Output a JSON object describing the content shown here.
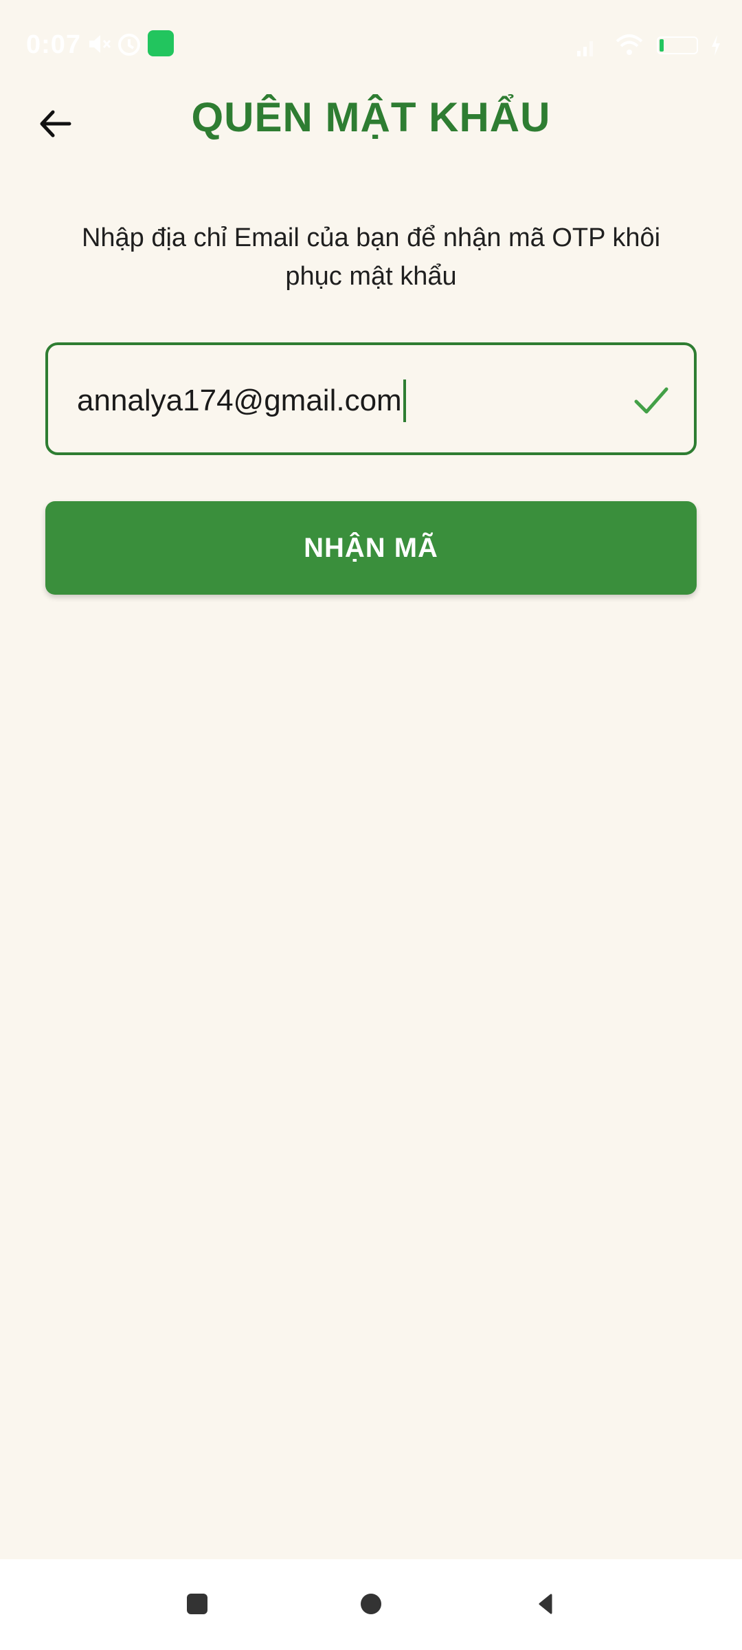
{
  "status_bar": {
    "time": "0:07"
  },
  "header": {
    "title": "QUÊN MẬT KHẨU",
    "back_icon": "arrow-left-icon"
  },
  "instruction": {
    "line1": "Nhập địa chỉ Email của bạn để nhận mã OTP khôi",
    "line2": "phục mật khẩu"
  },
  "email_field": {
    "value": "annalya174@gmail.com",
    "valid_icon": "check-icon"
  },
  "submit_button": {
    "label": "NHẬN MÃ"
  },
  "nav_bar": {
    "items": [
      "recents-icon",
      "home-icon",
      "back-icon"
    ]
  },
  "colors": {
    "accent": "#2e7d32",
    "button": "#3a8f3c",
    "background": "#faf6ee"
  }
}
